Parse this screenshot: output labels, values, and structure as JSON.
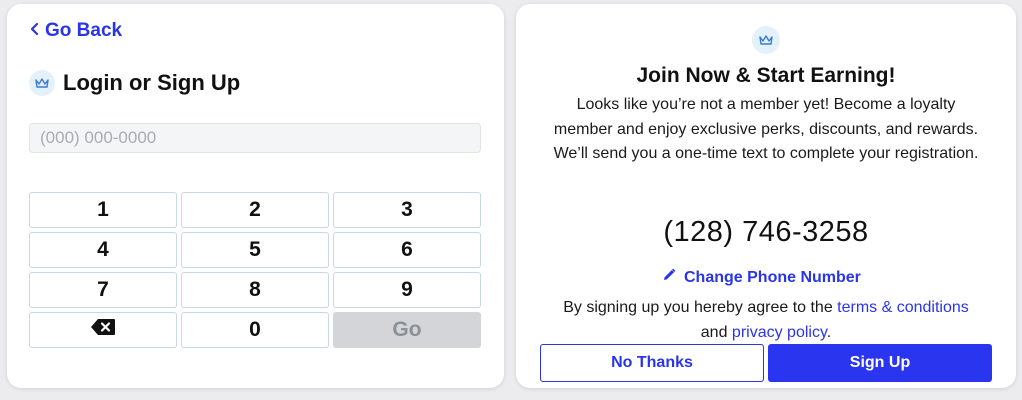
{
  "login": {
    "back_label": "Go Back",
    "title": "Login or Sign Up",
    "phone_placeholder": "(000) 000-0000",
    "keypad": {
      "k1": "1",
      "k2": "2",
      "k3": "3",
      "k4": "4",
      "k5": "5",
      "k6": "6",
      "k7": "7",
      "k8": "8",
      "k9": "9",
      "backspace_icon": "backspace-icon",
      "k0": "0",
      "go": "Go"
    }
  },
  "signup": {
    "icon": "crown-icon",
    "title": "Join Now & Start Earning!",
    "desc_line1": "Looks like you’re not a member yet! Become a loyalty member and enjoy exclusive perks, discounts, and rewards.",
    "desc_line2": "We’ll send you a one-time text to complete your registration.",
    "phone": "(128) 746-3258",
    "change_phone_label": "Change Phone Number",
    "agree_prefix": "By signing up you hereby agree to the",
    "terms_link": "terms & conditions",
    "agree_and": "and",
    "privacy_link": "privacy policy",
    "agree_suffix": ".",
    "no_thanks_label": "No Thanks",
    "sign_up_label": "Sign Up"
  },
  "colors": {
    "accent": "#2a35e8",
    "icon_bg": "#e3f1fb",
    "go_disabled": "#d3d5d9"
  }
}
